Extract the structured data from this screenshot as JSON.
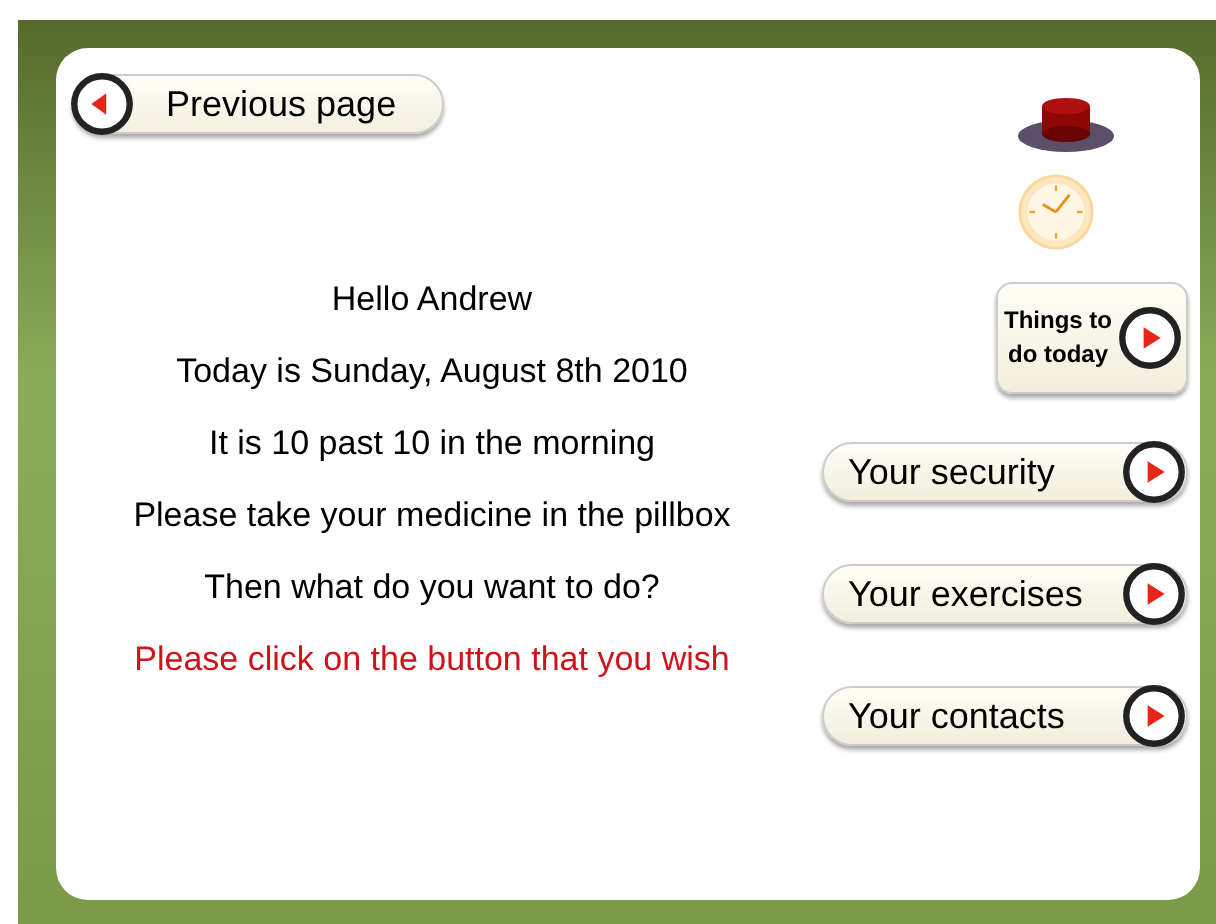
{
  "back_button": {
    "label": "Previous page"
  },
  "messages": [
    {
      "text": "Hello Andrew",
      "kind": "normal"
    },
    {
      "text": "Today is Sunday, August 8th 2010",
      "kind": "normal"
    },
    {
      "text": "It is 10 past 10 in the morning",
      "kind": "normal"
    },
    {
      "text": "Please take your medicine in the pillbox",
      "kind": "normal"
    },
    {
      "text": "Then what do you want to do?",
      "kind": "normal"
    },
    {
      "text": "Please click on the button that you wish",
      "kind": "alert"
    }
  ],
  "menu_buttons": [
    {
      "label": "Things to do today",
      "kind": "tall"
    },
    {
      "label": "Your security",
      "kind": "wide"
    },
    {
      "label": "Your exercises",
      "kind": "wide"
    },
    {
      "label": "Your contacts",
      "kind": "wide"
    }
  ]
}
